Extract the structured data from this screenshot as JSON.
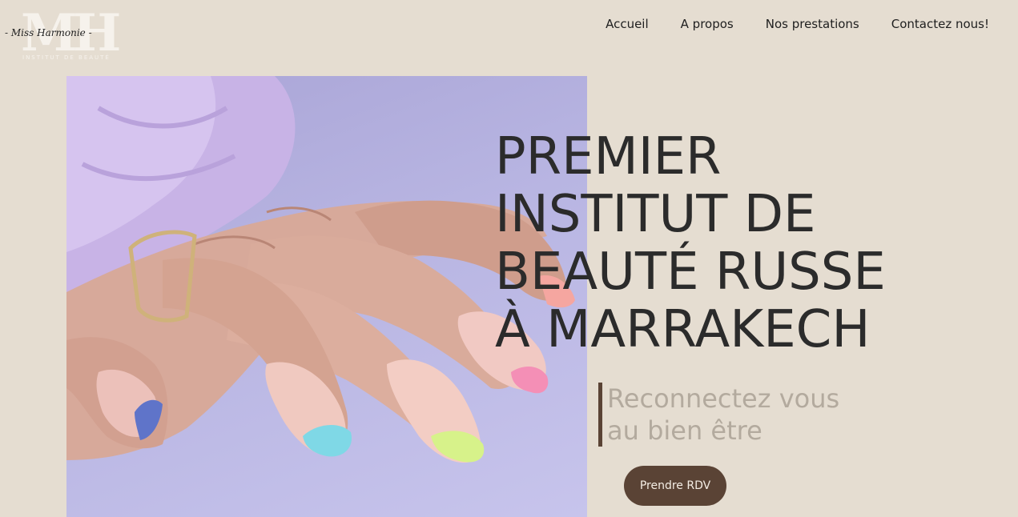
{
  "logo": {
    "monogram": "MH",
    "script_name": "- Miss Harmonie -",
    "tagline": "INSTITUT DE BEAUTÉ"
  },
  "nav": {
    "items": [
      {
        "label": "Accueil"
      },
      {
        "label": "A propos"
      },
      {
        "label": "Nos prestations"
      },
      {
        "label": "Contactez nous!"
      }
    ]
  },
  "hero": {
    "headline_lines": [
      "PREMIER",
      "INSTITUT DE",
      "BEAUTÉ RUSSE",
      "À MARRAKECH"
    ],
    "subtitle_lines": [
      "Reconnectez vous",
      "au bien être"
    ],
    "cta_label": "Prendre RDV"
  },
  "colors": {
    "background": "#e5ddd1",
    "accent_brown": "#5a4335",
    "subtitle_gray": "#b3aa9e",
    "headline": "#2b2b2b"
  }
}
